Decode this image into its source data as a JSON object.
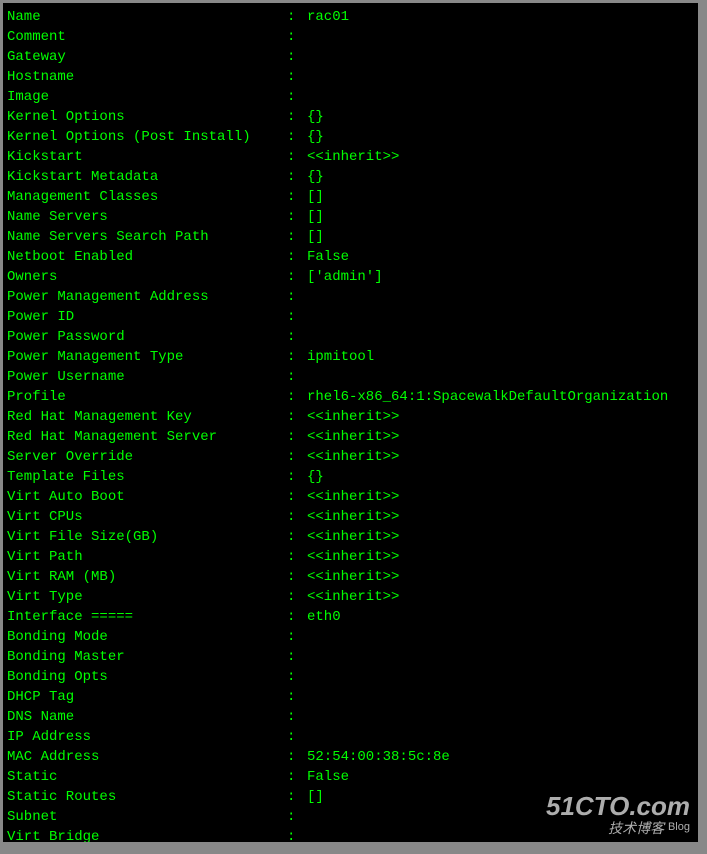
{
  "fields": [
    {
      "label": "Name",
      "value": "rac01"
    },
    {
      "label": "Comment",
      "value": ""
    },
    {
      "label": "Gateway",
      "value": ""
    },
    {
      "label": "Hostname",
      "value": ""
    },
    {
      "label": "Image",
      "value": ""
    },
    {
      "label": "Kernel Options",
      "value": "{}"
    },
    {
      "label": "Kernel Options (Post Install)",
      "value": "{}"
    },
    {
      "label": "Kickstart",
      "value": "<<inherit>>"
    },
    {
      "label": "Kickstart Metadata",
      "value": "{}"
    },
    {
      "label": "Management Classes",
      "value": "[]"
    },
    {
      "label": "Name Servers",
      "value": "[]"
    },
    {
      "label": "Name Servers Search Path",
      "value": "[]"
    },
    {
      "label": "Netboot Enabled",
      "value": "False"
    },
    {
      "label": "Owners",
      "value": "['admin']"
    },
    {
      "label": "Power Management Address",
      "value": ""
    },
    {
      "label": "Power ID",
      "value": ""
    },
    {
      "label": "Power Password",
      "value": ""
    },
    {
      "label": "Power Management Type",
      "value": "ipmitool"
    },
    {
      "label": "Power Username",
      "value": ""
    },
    {
      "label": "Profile",
      "value": "rhel6-x86_64:1:SpacewalkDefaultOrganization"
    },
    {
      "label": "Red Hat Management Key",
      "value": "<<inherit>>"
    },
    {
      "label": "Red Hat Management Server",
      "value": "<<inherit>>"
    },
    {
      "label": "Server Override",
      "value": "<<inherit>>"
    },
    {
      "label": "Template Files",
      "value": "{}"
    },
    {
      "label": "Virt Auto Boot",
      "value": "<<inherit>>"
    },
    {
      "label": "Virt CPUs",
      "value": "<<inherit>>"
    },
    {
      "label": "Virt File Size(GB)",
      "value": "<<inherit>>"
    },
    {
      "label": "Virt Path",
      "value": "<<inherit>>"
    },
    {
      "label": "Virt RAM (MB)",
      "value": "<<inherit>>"
    },
    {
      "label": "Virt Type",
      "value": "<<inherit>>"
    },
    {
      "label": "Interface =====",
      "value": "eth0"
    },
    {
      "label": "Bonding Mode",
      "value": ""
    },
    {
      "label": "Bonding Master",
      "value": ""
    },
    {
      "label": "Bonding Opts",
      "value": ""
    },
    {
      "label": "DHCP Tag",
      "value": ""
    },
    {
      "label": "DNS Name",
      "value": ""
    },
    {
      "label": "IP Address",
      "value": ""
    },
    {
      "label": "MAC Address",
      "value": "52:54:00:38:5c:8e"
    },
    {
      "label": "Static",
      "value": "False"
    },
    {
      "label": "Static Routes",
      "value": "[]"
    },
    {
      "label": "Subnet",
      "value": ""
    },
    {
      "label": "Virt Bridge",
      "value": ""
    }
  ],
  "watermark": {
    "main": "51CTO.com",
    "sub": "技术博客",
    "blog": "Blog"
  }
}
